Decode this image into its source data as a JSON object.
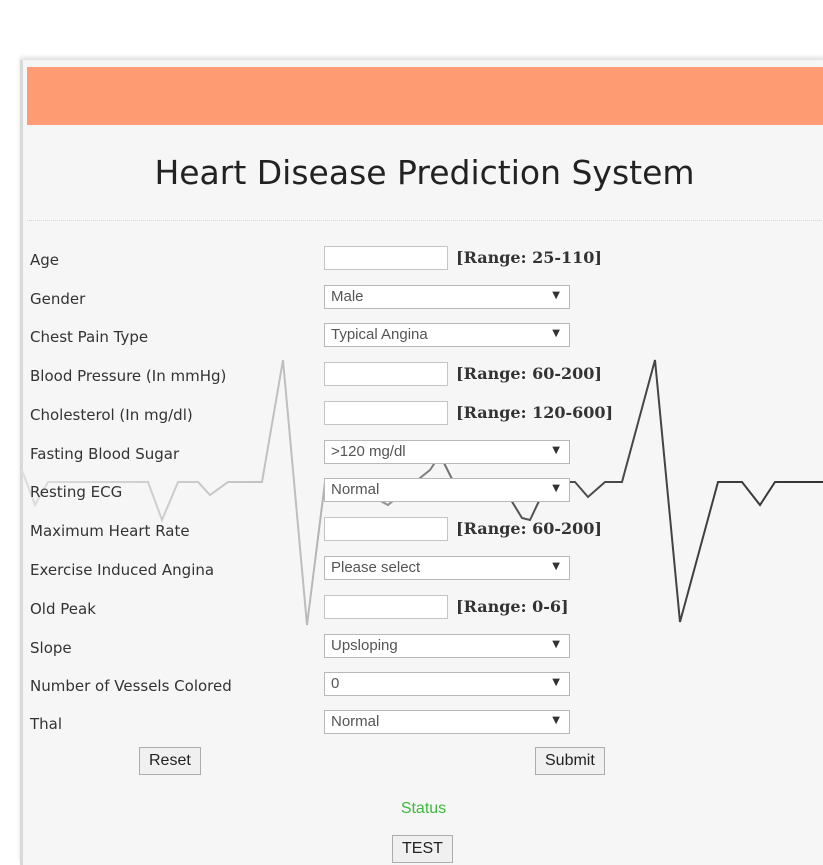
{
  "header": {
    "title": "Heart Disease Prediction System",
    "bar_color": "#ff9b73"
  },
  "fields": {
    "age": {
      "label": "Age",
      "value": "",
      "range": "[Range: 25-110]"
    },
    "gender": {
      "label": "Gender",
      "selected": "Male"
    },
    "chest_pain": {
      "label": "Chest Pain Type",
      "selected": "Typical Angina"
    },
    "blood_pressure": {
      "label": "Blood Pressure (In mmHg)",
      "value": "",
      "range": "[Range: 60-200]"
    },
    "cholesterol": {
      "label": "Cholesterol (In mg/dl)",
      "value": "",
      "range": "[Range: 120-600]"
    },
    "fasting_sugar": {
      "label": "Fasting Blood Sugar",
      "selected": ">120 mg/dl"
    },
    "resting_ecg": {
      "label": "Resting ECG",
      "selected": "Normal"
    },
    "max_heart_rate": {
      "label": "Maximum Heart Rate",
      "value": "",
      "range": "[Range: 60-200]"
    },
    "exercise_angina": {
      "label": "Exercise Induced Angina",
      "selected": "Please select"
    },
    "old_peak": {
      "label": "Old Peak",
      "value": "",
      "range": "[Range: 0-6]"
    },
    "slope": {
      "label": "Slope",
      "selected": "Upsloping"
    },
    "vessels": {
      "label": "Number of Vessels Colored",
      "selected": "0"
    },
    "thal": {
      "label": "Thal",
      "selected": "Normal"
    }
  },
  "icons": {
    "dropdown_arrow": "▼",
    "background": "ecg-waveform"
  },
  "buttons": {
    "reset": "Reset",
    "submit": "Submit",
    "test": "TEST"
  },
  "status": {
    "text": "Status",
    "color": "#3db83d"
  }
}
